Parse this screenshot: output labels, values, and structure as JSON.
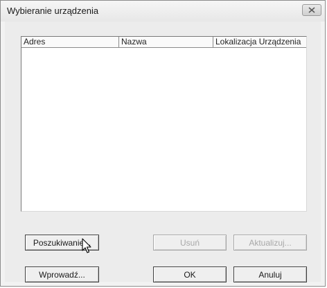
{
  "window": {
    "title": "Wybieranie urządzenia"
  },
  "device_list": {
    "columns": [
      "Adres",
      "Nazwa",
      "Lokalizacja Urządzenia"
    ],
    "rows": []
  },
  "buttons": {
    "search": "Poszukiwanie...",
    "remove": "Usuń",
    "update": "Aktualizuj...",
    "enter": "Wprowadź...",
    "ok": "OK",
    "cancel": "Anuluj"
  },
  "icons": {
    "close": "close-icon",
    "cursor": "mouse-pointer-icon"
  }
}
